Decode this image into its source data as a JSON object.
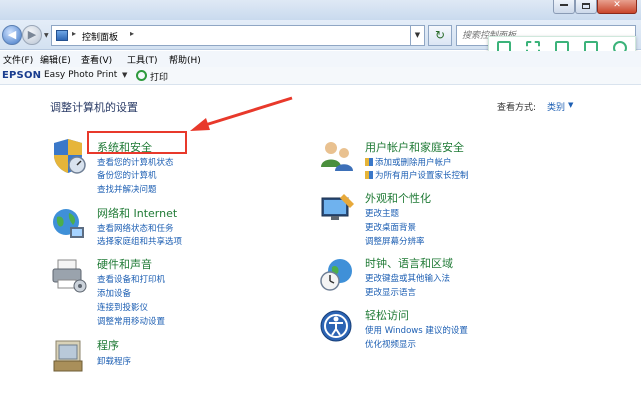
{
  "window": {
    "close_glyph": "✕"
  },
  "nav": {
    "back_glyph": "◀",
    "forward_glyph": "▶",
    "breadcrumb_separator": "▸",
    "breadcrumb": "控制面板",
    "refresh_glyph": "↻",
    "search_placeholder": "搜索控制面板"
  },
  "menu": {
    "items": [
      "文件(F)",
      "编辑(E)",
      "查看(V)",
      "工具(T)",
      "帮助(H)"
    ]
  },
  "epson": {
    "logo": "EPSON",
    "app": "Easy Photo Print",
    "print_label": "打印"
  },
  "main": {
    "title": "调整计算机的设置",
    "view_mode_label": "查看方式:",
    "view_mode_value": "类别",
    "categories": [
      {
        "title": "系统和安全",
        "links": [
          "查看您的计算机状态",
          "备份您的计算机",
          "查找并解决问题"
        ]
      },
      {
        "title": "网络和 Internet",
        "links": [
          "查看网络状态和任务",
          "选择家庭组和共享选项"
        ]
      },
      {
        "title": "硬件和声音",
        "links": [
          "查看设备和打印机",
          "添加设备",
          "连接到投影仪",
          "调整常用移动设置"
        ]
      },
      {
        "title": "程序",
        "links": [
          "卸载程序"
        ]
      },
      {
        "title": "用户帐户和家庭安全",
        "links": [
          "添加或删除用户帐户",
          "为所有用户设置家长控制"
        ]
      },
      {
        "title": "外观和个性化",
        "links": [
          "更改主题",
          "更改桌面背景",
          "调整屏幕分辨率"
        ]
      },
      {
        "title": "时钟、语言和区域",
        "links": [
          "更改键盘或其他输入法",
          "更改显示语言"
        ]
      },
      {
        "title": "轻松访问",
        "links": [
          "使用 Windows 建议的设置",
          "优化视频显示"
        ]
      }
    ]
  },
  "colors": {
    "category_title": "#1f7a35",
    "link": "#1d5fb3",
    "annotation": "#e8392b"
  }
}
